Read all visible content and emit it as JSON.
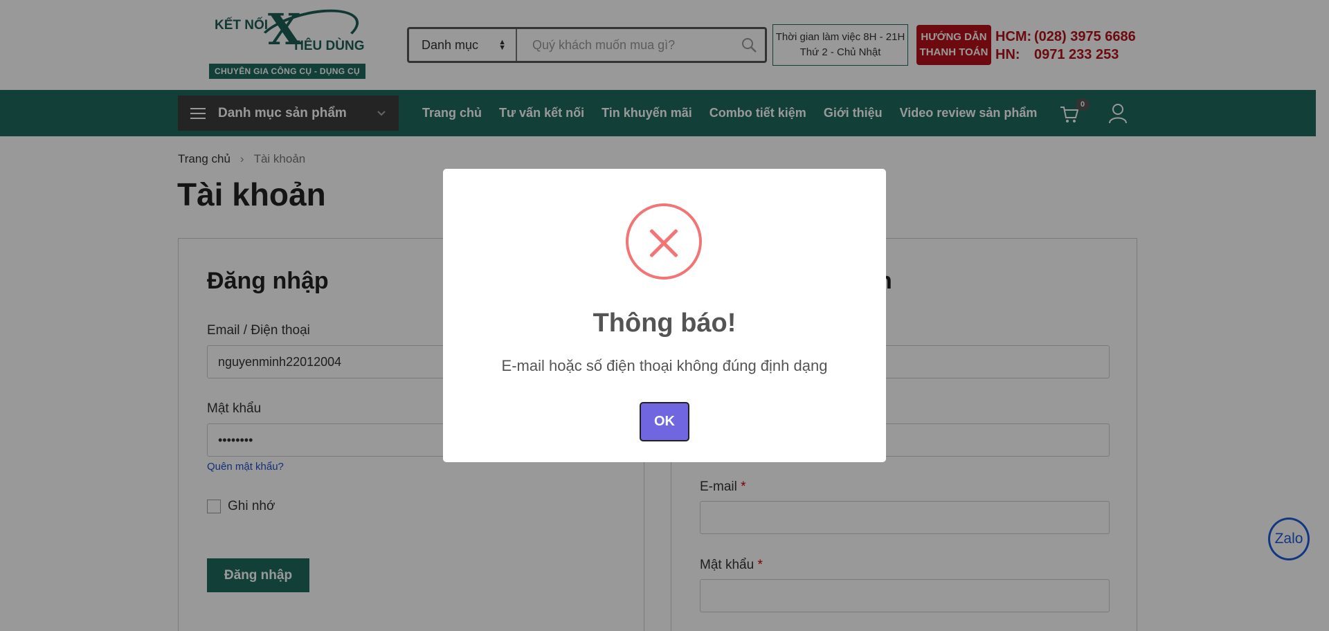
{
  "header": {
    "logo": {
      "line1": "KẾT NỐI",
      "big_x": "X",
      "line2": "TIÊU DÙNG",
      "tagline": "CHUYÊN GIA CÔNG CỤ - DỤNG CỤ"
    },
    "search": {
      "category_label": "Danh mục",
      "placeholder": "Quý khách muốn mua gì?",
      "icon": "search-icon"
    },
    "hours": {
      "line1": "Thời gian làm việc 8H - 21H",
      "line2": "Thứ 2 - Chủ Nhật"
    },
    "payment_guide": {
      "line1": "HƯỚNG DẪN",
      "line2": "THANH TOÁN"
    },
    "phones": {
      "hcm_label": "HCM:",
      "hcm_number": "(028) 3975 6686",
      "hn_label": "HN:",
      "hn_number": "0971 233 253"
    }
  },
  "nav": {
    "category_button": "Danh mục sản phẩm",
    "items": [
      {
        "label": "Trang chủ"
      },
      {
        "label": "Tư vấn kết nối"
      },
      {
        "label": "Tin khuyến mãi"
      },
      {
        "label": "Combo tiết kiệm"
      },
      {
        "label": "Giới thiệu"
      },
      {
        "label": "Video review sản phẩm"
      }
    ],
    "cart_count": "0",
    "colors": {
      "nav_bg": "#1f6b60",
      "category_bg": "#3c3c3c"
    }
  },
  "breadcrumb": {
    "home": "Trang chủ",
    "separator": "›",
    "current": "Tài khoản"
  },
  "page_title": "Tài khoản",
  "login": {
    "title": "Đăng nhập",
    "email_label": "Email / Điện thoại",
    "email_value": "nguyenminh22012004",
    "password_label": "Mật khẩu",
    "password_value": "••••••••",
    "forgot": "Quên mật khẩu?",
    "remember": "Ghi nhớ",
    "submit": "Đăng nhập"
  },
  "register": {
    "title_partial": "n",
    "email_label": "E-mail",
    "password_label": "Mật khẩu",
    "required_mark": "*"
  },
  "zalo": {
    "label": "Zalo"
  },
  "modal": {
    "title": "Thông báo!",
    "message": "E-mail hoặc số điện thoại không đúng định dạng",
    "ok": "OK",
    "icon": "error-x-icon",
    "colors": {
      "icon": "#f27474",
      "ok_bg": "#7066e0"
    }
  }
}
